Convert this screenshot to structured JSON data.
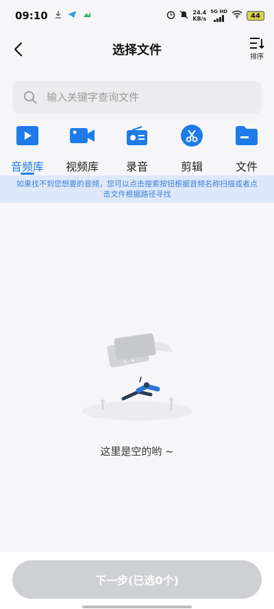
{
  "status_bar": {
    "time": "09:10",
    "net_speed_value": "24.4",
    "net_speed_unit": "KB/s",
    "network_label": "5G HD",
    "battery": "44"
  },
  "header": {
    "title": "选择文件",
    "sort_label": "排序"
  },
  "search": {
    "placeholder": "输入关键字查询文件"
  },
  "tabs": [
    {
      "label": "音频库",
      "icon": "play-icon",
      "active": true
    },
    {
      "label": "视频库",
      "icon": "video-camera-icon",
      "active": false
    },
    {
      "label": "录音",
      "icon": "radio-recorder-icon",
      "active": false
    },
    {
      "label": "剪辑",
      "icon": "scissors-icon",
      "active": false
    },
    {
      "label": "文件",
      "icon": "folder-icon",
      "active": false
    }
  ],
  "hint": {
    "text": "如果找不到您想要的音频，您可以点击搜索按钮根据音频名称扫描或者点击文件根据路径寻找"
  },
  "empty_state": {
    "text": "这里是空的哟 ~"
  },
  "footer": {
    "next_label": "下一步(已选0个)"
  },
  "colors": {
    "accent": "#1e7be8",
    "hint_bg": "#dde9fa",
    "hint_text": "#3d7fd6",
    "button_disabled": "#cfd0d3"
  }
}
